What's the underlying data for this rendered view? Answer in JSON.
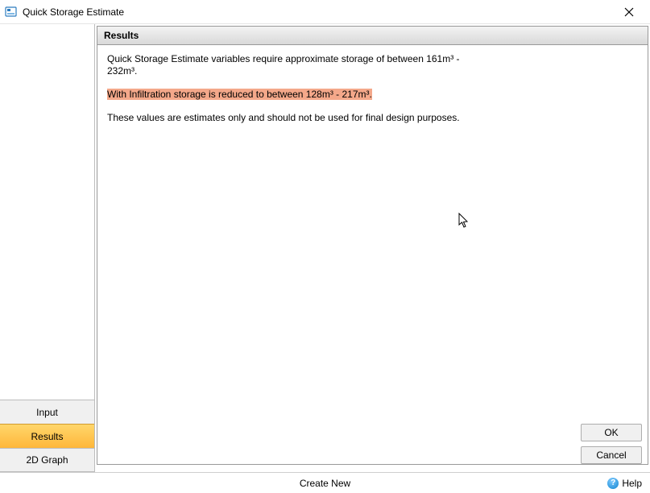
{
  "window": {
    "title": "Quick Storage Estimate"
  },
  "sidebar": {
    "tabs": [
      {
        "label": "Input"
      },
      {
        "label": "Results"
      },
      {
        "label": "2D Graph"
      }
    ],
    "selected_index": 1
  },
  "panel": {
    "header": "Results",
    "para1": "Quick Storage Estimate variables require approximate storage of between 161m³ - 232m³.",
    "para2_highlight": "With Infiltration storage is reduced to between 128m³ - 217m³.",
    "para3": "These values are estimates only and should not be used for final design purposes."
  },
  "buttons": {
    "ok": "OK",
    "cancel": "Cancel"
  },
  "statusbar": {
    "create_new": "Create New",
    "help": "Help"
  }
}
